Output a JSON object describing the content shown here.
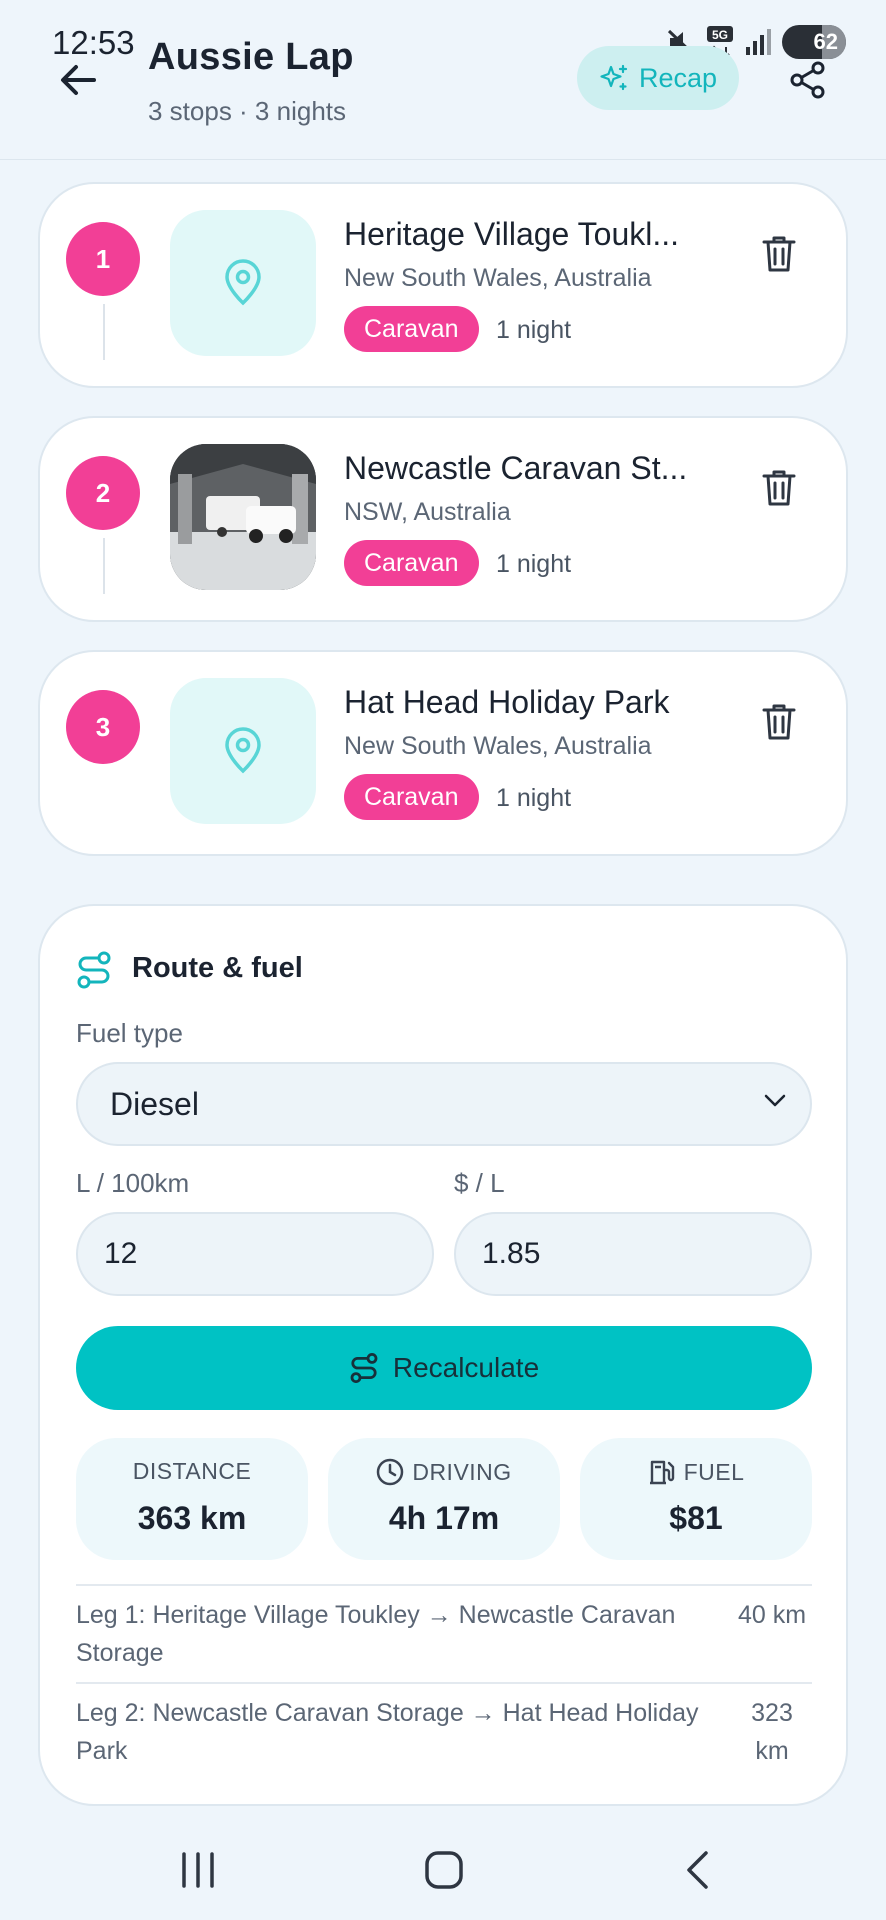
{
  "status_bar": {
    "time": "12:53",
    "network": "5G",
    "battery": "62"
  },
  "header": {
    "title": "Aussie Lap",
    "subtitle": "3 stops · 3 nights",
    "recap_label": "Recap"
  },
  "stops": [
    {
      "number": "1",
      "name": "Heritage Village Toukl...",
      "region": "New South Wales, Australia",
      "type": "Caravan",
      "nights": "1 night",
      "has_photo": false
    },
    {
      "number": "2",
      "name": "Newcastle Caravan St...",
      "region": "NSW, Australia",
      "type": "Caravan",
      "nights": "1 night",
      "has_photo": true
    },
    {
      "number": "3",
      "name": "Hat Head Holiday Park",
      "region": "New South Wales, Australia",
      "type": "Caravan",
      "nights": "1 night",
      "has_photo": false
    }
  ],
  "route": {
    "title": "Route & fuel",
    "fuel_type_label": "Fuel type",
    "fuel_type_value": "Diesel",
    "consumption_label": "L / 100km",
    "consumption_value": "12",
    "price_label": "$ / L",
    "price_value": "1.85",
    "recalculate_label": "Recalculate",
    "stats": {
      "distance_label": "DISTANCE",
      "distance_value": "363 km",
      "driving_label": "DRIVING",
      "driving_value": "4h 17m",
      "fuel_label": "FUEL",
      "fuel_value": "$81"
    },
    "legs": [
      {
        "text": "Leg 1: Heritage Village Toukley → Newcastle Caravan Storage",
        "distance": "40 km"
      },
      {
        "text": "Leg 2: Newcastle Caravan Storage → Hat Head Holiday Park",
        "distance": "323 km"
      }
    ]
  },
  "colors": {
    "accent_pink": "#F23F96",
    "accent_teal": "#00C2C4",
    "background": "#EEF5FB"
  }
}
